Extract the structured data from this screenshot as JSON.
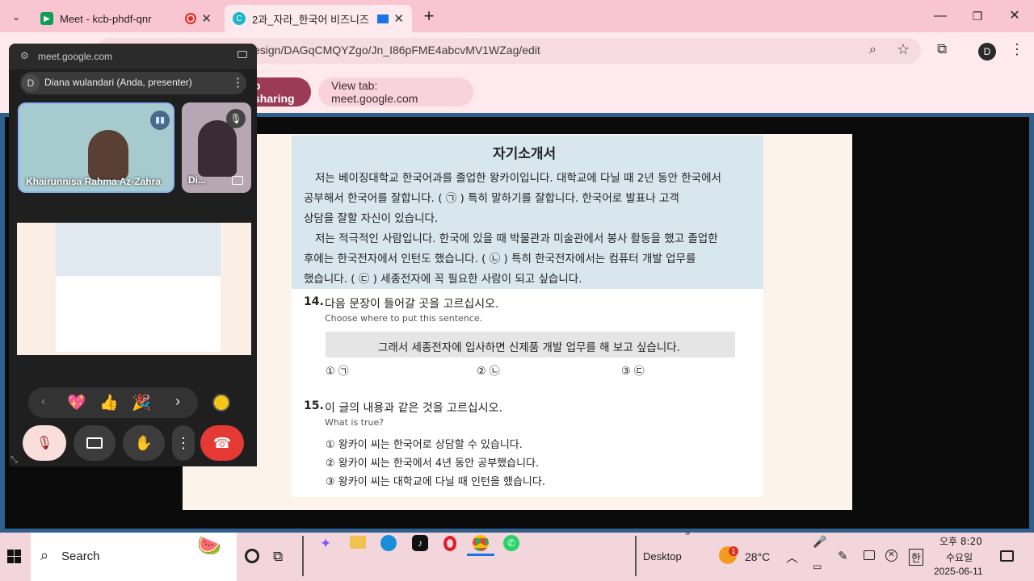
{
  "browser": {
    "tabs": [
      {
        "label": "Meet - kcb-phdf-qnr",
        "recording": true
      },
      {
        "label": "2과_자라_한국어 비즈니즈"
      }
    ],
    "new_tab": "+",
    "url": "esign/DAGqCMQYZgo/Jn_I86pFME4abcvMV1WZag/edit",
    "profile_initial": "D"
  },
  "sharing": {
    "stop_label": "o sharing",
    "view_label": "View tab: meet.google.com"
  },
  "document": {
    "title": "자기소개서",
    "para_lines": [
      "저는 베이징대학교 한국어과를 졸업한 왕카이입니다. 대학교에 다닐 때 2년 동안 한국에서",
      "공부해서 한국어를 잘합니다. (    ㉠    ) 특히 말하기를 잘합니다. 한국어로 발표나 고객",
      "상담을 잘할 자신이 있습니다.",
      "저는 적극적인 사람입니다. 한국에 있을 때 박물관과 미술관에서 봉사 활동을 했고 졸업한",
      "후에는 한국전자에서 인턴도 했습니다. (    ㉡    ) 특히 한국전자에서는 컴퓨터 개발 업무를",
      "했습니다. (    ㉢    ) 세종전자에 꼭 필요한 사람이 되고 싶습니다."
    ],
    "q14": {
      "number": "14.",
      "question": "다음 문장이 들어갈 곳을 고르십시오.",
      "sub": "Choose where to put this sentence.",
      "sentence": "그래서 세종전자에 입사하면 신제품 개발 업무를 해 보고 싶습니다.",
      "options": [
        "① ㉠",
        "② ㉡",
        "③ ㉢"
      ]
    },
    "q15": {
      "number": "15.",
      "question": "이 글의 내용과 같은 것을 고르십시오.",
      "sub": "What is true?",
      "options": [
        "① 왕카이 씨는 한국어로 상담할 수 있습니다.",
        "② 왕카이 씨는 한국에서 4년 동안 공부했습니다.",
        "③ 왕카이 씨는 대학교에 다닐 때 인턴을 했습니다."
      ]
    }
  },
  "meet": {
    "url": "meet.google.com",
    "presenter_initial": "D",
    "presenter": "Diana wulandari (Anda, presenter)",
    "participants": [
      {
        "name": "Khairunnisa Rahma Az-Zahra"
      },
      {
        "name": "Di..."
      }
    ],
    "reactions": [
      "💖",
      "👍",
      "🎉"
    ]
  },
  "taskbar": {
    "search": "Search",
    "desktop": "Desktop",
    "weather": "28°C",
    "weather_badge": "1",
    "ime": "한",
    "time": "오후 8:20",
    "day": "수요일",
    "date": "2025-06-11"
  }
}
